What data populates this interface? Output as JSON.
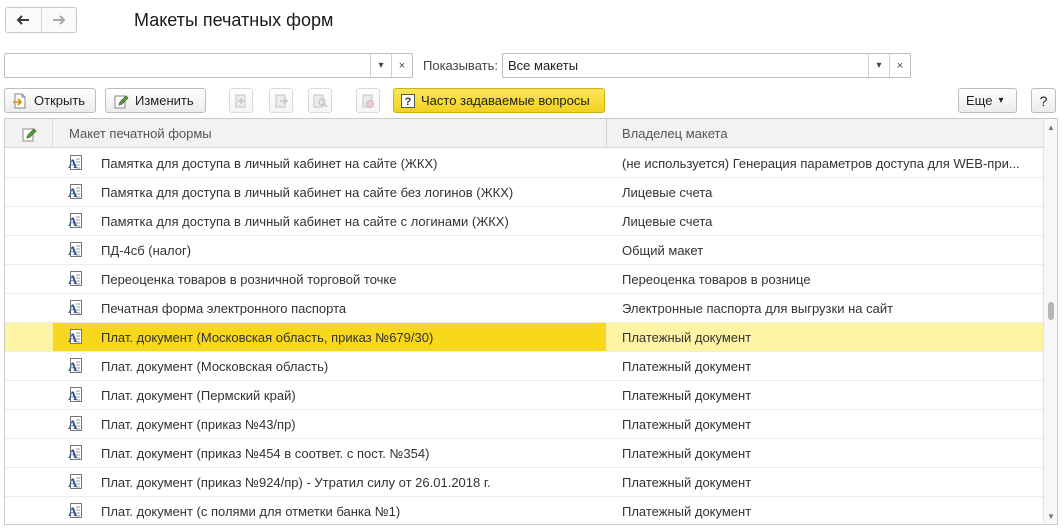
{
  "window": {
    "title": "Макеты печатных форм"
  },
  "filter": {
    "search_value": "",
    "show_label": "Показывать:",
    "show_value": "Все макеты",
    "clear_glyph": "×",
    "dropdown_glyph": "▾"
  },
  "toolbar": {
    "open_label": "Открыть",
    "edit_label": "Изменить",
    "faq_label": "Часто задаваемые вопросы",
    "more_label": "Еще",
    "help_label": "?"
  },
  "table": {
    "columns": [
      "Макет печатной формы",
      "Владелец макета"
    ],
    "rows": [
      {
        "name": "Памятка для доступа в личный кабинет на сайте (ЖКХ)",
        "owner": "(не используется) Генерация параметров доступа для WEB-при..."
      },
      {
        "name": "Памятка для доступа в личный кабинет на сайте без логинов (ЖКХ)",
        "owner": "Лицевые счета"
      },
      {
        "name": "Памятка для доступа в личный кабинет на сайте с логинами (ЖКХ)",
        "owner": "Лицевые счета"
      },
      {
        "name": "ПД-4сб (налог)",
        "owner": "Общий макет"
      },
      {
        "name": "Переоценка товаров в розничной торговой точке",
        "owner": "Переоценка товаров в рознице"
      },
      {
        "name": "Печатная форма электронного паспорта",
        "owner": "Электронные паспорта для выгрузки на сайт"
      },
      {
        "name": "Плат. документ (Московская область, приказ №679/30)",
        "owner": "Платежный документ",
        "selected": true
      },
      {
        "name": "Плат. документ (Московская область)",
        "owner": "Платежный документ"
      },
      {
        "name": "Плат. документ (Пермский край)",
        "owner": "Платежный документ"
      },
      {
        "name": "Плат. документ (приказ №43/пр)",
        "owner": "Платежный документ"
      },
      {
        "name": "Плат. документ (приказ №454 в соответ. с пост. №354)",
        "owner": "Платежный документ"
      },
      {
        "name": "Плат. документ (приказ №924/пр) - Утратил силу от 26.01.2018 г.",
        "owner": "Платежный документ"
      },
      {
        "name": "Плат. документ (с полями для отметки банка №1)",
        "owner": "Платежный документ"
      }
    ]
  },
  "icons": {
    "back": "arrow-left-icon",
    "forward": "arrow-right-icon",
    "open": "open-document-icon",
    "edit": "edit-pencil-icon",
    "faq": "question-icon",
    "row": "template-document-icon"
  },
  "colors": {
    "selected_cell": "#f7d81c",
    "selected_row": "#fdf4a6",
    "faq_button": "#f4d726"
  }
}
